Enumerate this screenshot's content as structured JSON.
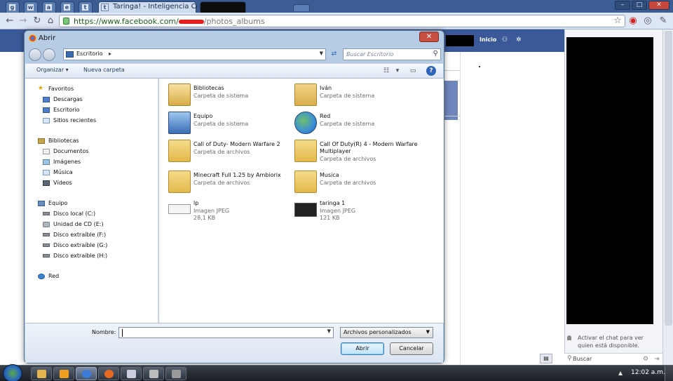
{
  "browser": {
    "tabs": [
      {
        "favicon": "g"
      },
      {
        "favicon": "w"
      },
      {
        "favicon": "a"
      },
      {
        "favicon": "e"
      },
      {
        "favicon": "t"
      },
      {
        "favicon": "t",
        "label": "Taringa! - Inteligencia Co"
      },
      {
        "favicon": "",
        "label": ""
      }
    ],
    "url_prefix": "https://www.facebook.com/",
    "url_suffix": "/photos_albums",
    "window_controls": {
      "minimize": "–",
      "maximize": "□",
      "close": "✕"
    }
  },
  "facebook": {
    "home_link": "Inicio",
    "chat_notice": "Activar el chat para ver quien está disponible.",
    "chat_search": "Buscar"
  },
  "dialog": {
    "title": "Abrir",
    "close_glyph": "✕",
    "location": "Escritorio",
    "search_placeholder": "Buscar Escritorio",
    "commands": {
      "organize": "Organizar",
      "new_folder": "Nueva carpeta"
    },
    "nav": [
      {
        "label": "Favoritos",
        "icon": "star-icon"
      },
      {
        "label": "Descargas",
        "icon": "downloads-folder-icon"
      },
      {
        "label": "Escritorio",
        "icon": "desktop-folder-icon"
      },
      {
        "label": "Sitios recientes",
        "icon": "recent-places-icon"
      },
      {
        "label": "Bibliotecas",
        "icon": "libraries-icon"
      },
      {
        "label": "Documentos",
        "icon": "documents-icon"
      },
      {
        "label": "Imágenes",
        "icon": "pictures-icon"
      },
      {
        "label": "Música",
        "icon": "music-icon"
      },
      {
        "label": "Vídeos",
        "icon": "videos-icon"
      },
      {
        "label": "Equipo",
        "icon": "computer-icon"
      },
      {
        "label": "Disco local (C:)",
        "icon": "hard-drive-icon"
      },
      {
        "label": "Unidad de CD (E:)",
        "icon": "cd-drive-icon"
      },
      {
        "label": "Disco extraíble (F:)",
        "icon": "removable-drive-icon"
      },
      {
        "label": "Disco extraíble (G:)",
        "icon": "removable-drive-icon"
      },
      {
        "label": "Disco extraíble (H:)",
        "icon": "removable-drive-icon"
      },
      {
        "label": "Red",
        "icon": "network-icon"
      }
    ],
    "files": [
      {
        "name": "Bibliotecas",
        "line2": "Carpeta de sistema",
        "line3": "",
        "icon": "libraries-icon"
      },
      {
        "name": "Iván",
        "line2": "Carpeta de sistema",
        "line3": "",
        "icon": "user-folder-icon"
      },
      {
        "name": "Equipo",
        "line2": "Carpeta de sistema",
        "line3": "",
        "icon": "computer-icon"
      },
      {
        "name": "Red",
        "line2": "Carpeta de sistema",
        "line3": "",
        "icon": "network-icon"
      },
      {
        "name": "Call of Duty- Modern Warfare 2",
        "line2": "Carpeta de archivos",
        "line3": "",
        "icon": "folder-icon"
      },
      {
        "name": "Call Of Duty(R) 4 - Modern Warfare",
        "name2": "Multiplayer",
        "line2": "Carpeta de archivos",
        "line3": "",
        "icon": "folder-icon"
      },
      {
        "name": "Minecraft Full 1.25 by Ambiorix",
        "line2": "Carpeta de archivos",
        "line3": "",
        "icon": "folder-icon"
      },
      {
        "name": "Musica",
        "line2": "Carpeta de archivos",
        "line3": "",
        "icon": "folder-icon"
      },
      {
        "name": "lp",
        "line2": "Imagen JPEG",
        "line3": "28,1 KB",
        "icon": "image-thumbnail-icon"
      },
      {
        "name": "taringa 1",
        "line2": "Imagen JPEG",
        "line3": "121 KB",
        "icon": "image-thumbnail-icon"
      }
    ],
    "filename_label": "Nombre:",
    "filename_value": "",
    "filetype": "Archivos personalizados",
    "open_button": "Abrir",
    "cancel_button": "Cancelar"
  },
  "taskbar": {
    "clock": "12:02 a.m."
  }
}
